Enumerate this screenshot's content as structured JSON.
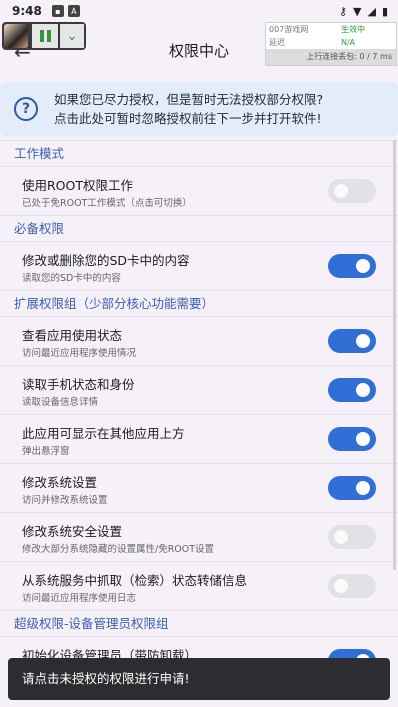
{
  "statusbar": {
    "time": "9:48",
    "icons": [
      "notification-square-icon",
      "notification-a-icon"
    ],
    "right_icons": [
      "key-icon",
      "wifi-icon",
      "signal-icon",
      "battery-icon"
    ]
  },
  "header": {
    "title": "权限中心",
    "back_icon": "arrow-left-icon"
  },
  "overlay": {
    "pause_icon": "pause-icon",
    "expand_icon": "chevron-down-icon"
  },
  "info_panel": {
    "rows": [
      {
        "key": "007游戏网",
        "value": "生效中"
      },
      {
        "key": "延迟",
        "value": "N/A"
      }
    ],
    "footer": "上行连接丢包: 0 / 7 ms"
  },
  "notice": {
    "line1": "如果您已尽力授权，但是暂时无法授权部分权限?",
    "line2": "点击此处可暂时忽略授权前往下一步并打开软件!",
    "icon": "question-circle-icon"
  },
  "sections": [
    {
      "title": "工作模式",
      "items": [
        {
          "title": "使用ROOT权限工作",
          "subtitle": "已处于免ROOT工作模式（点击可切换）",
          "on": false
        }
      ]
    },
    {
      "title": "必备权限",
      "items": [
        {
          "title": "修改或删除您的SD卡中的内容",
          "subtitle": "读取您的SD卡中的内容",
          "on": true
        }
      ]
    },
    {
      "title": "扩展权限组（少部分核心功能需要）",
      "items": [
        {
          "title": "查看应用使用状态",
          "subtitle": "访问最近应用程序使用情况",
          "on": true
        },
        {
          "title": "读取手机状态和身份",
          "subtitle": "读取设备信息详情",
          "on": true
        },
        {
          "title": "此应用可显示在其他应用上方",
          "subtitle": "弹出悬浮窗",
          "on": true
        },
        {
          "title": "修改系统设置",
          "subtitle": "访问并修改系统设置",
          "on": true
        },
        {
          "title": "修改系统安全设置",
          "subtitle": "修改大部分系统隐藏的设置属性/免ROOT设置",
          "on": false
        },
        {
          "title": "从系统服务中抓取（检索）状态转储信息",
          "subtitle": "访问最近应用程序使用日志",
          "on": false
        }
      ]
    },
    {
      "title": "超级权限-设备管理员权限组",
      "items": [
        {
          "title": "初始化设备管理员（带防卸载）",
          "subtitle": "",
          "on": true
        }
      ]
    }
  ],
  "snackbar": {
    "message": "请点击未授权的权限进行申请!"
  }
}
